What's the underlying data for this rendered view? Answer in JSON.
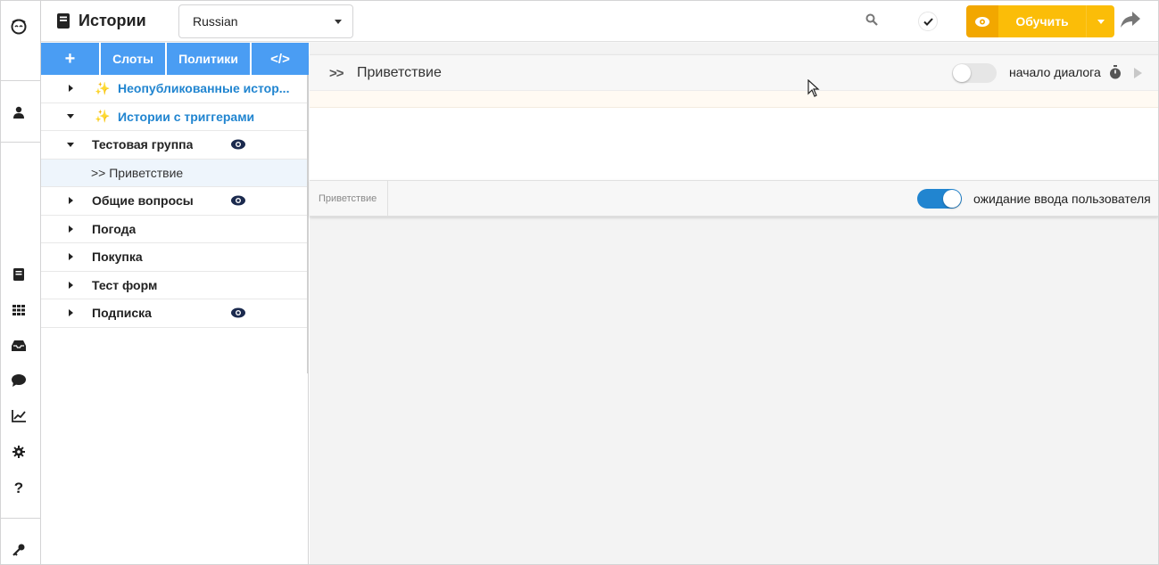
{
  "app": {
    "title": "Истории",
    "language": "Russian"
  },
  "rail": {
    "icons": [
      "logo-icon",
      "user-icon",
      "book-icon",
      "grid-icon",
      "inbox-icon",
      "chat-icon",
      "chart-icon",
      "gear-icon",
      "help-icon",
      "key-icon"
    ]
  },
  "toolbar": {
    "add_label": "+",
    "slots_label": "Слоты",
    "policies_label": "Политики",
    "code_label": "</>",
    "train_label": "Обучить"
  },
  "tree": {
    "items": [
      {
        "label": "Неопубликованные истор...",
        "kind": "smart",
        "expanded": false,
        "eye": false
      },
      {
        "label": "Истории с триггерами",
        "kind": "smart",
        "expanded": true,
        "eye": false
      },
      {
        "label": "Тестовая группа",
        "kind": "group",
        "expanded": true,
        "eye": true
      },
      {
        "label": ">> Приветствие",
        "kind": "story",
        "selected": true
      },
      {
        "label": "Общие вопросы",
        "kind": "group",
        "expanded": false,
        "eye": true
      },
      {
        "label": "Погода",
        "kind": "group",
        "expanded": false,
        "eye": false
      },
      {
        "label": "Покупка",
        "kind": "group",
        "expanded": false,
        "eye": false
      },
      {
        "label": "Тест форм",
        "kind": "group",
        "expanded": false,
        "eye": false
      },
      {
        "label": "Подписка",
        "kind": "group",
        "expanded": false,
        "eye": true
      }
    ]
  },
  "story": {
    "title": "Приветствие",
    "chevron": ">>",
    "start_toggle_label": "начало диалога",
    "start_toggle_on": false,
    "breadcrumb": "Приветствие",
    "wait_toggle_label": "ожидание ввода пользователя",
    "wait_toggle_on": true
  },
  "colors": {
    "accent_blue": "#2185d0",
    "toolbar_blue": "#4a9df3",
    "train_yellow": "#fbbd08"
  }
}
